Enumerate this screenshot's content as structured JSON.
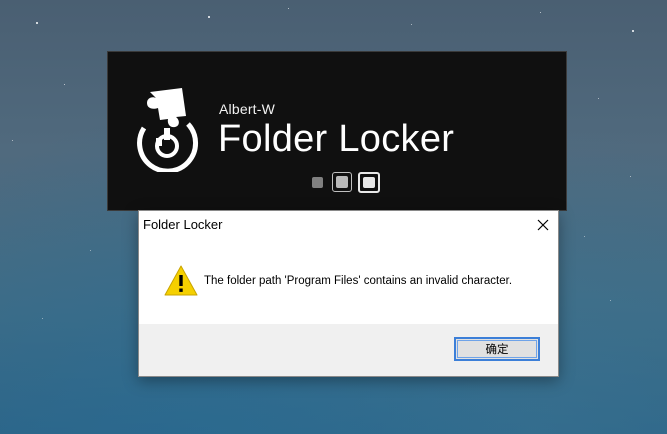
{
  "splash": {
    "vendor": "Albert-W",
    "title": "Folder Locker",
    "logo_icon": "puzzle-lock-logo",
    "loading_dots": 3
  },
  "dialog": {
    "title": "Folder Locker",
    "close_icon": "close-icon",
    "message_icon": "warning-icon",
    "message": "The folder path 'Program Files' contains an invalid character.",
    "ok_label": "确定"
  },
  "colors": {
    "splash_bg": "#101010",
    "dialog_bg": "#ffffff",
    "footer_bg": "#f0f0f0",
    "ok_border": "#3c7fd8",
    "warning_yellow": "#f5d000"
  }
}
